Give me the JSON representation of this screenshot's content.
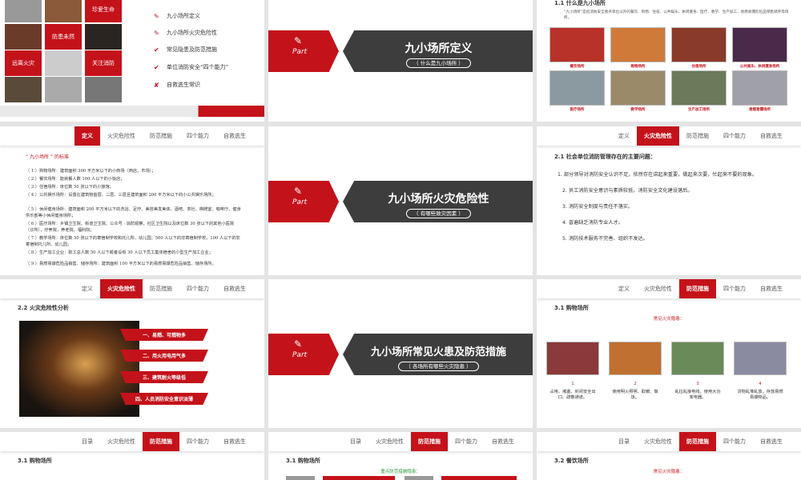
{
  "slide1": {
    "tiles": [
      "珍爱生命",
      "防患未然",
      "远离火灾",
      "关注消防"
    ],
    "toc": [
      {
        "icon": "fire-icon",
        "glyph": "✎",
        "label": "九小场所定义"
      },
      {
        "icon": "pencil-icon",
        "glyph": "✎",
        "label": "九小场所火灾危险性"
      },
      {
        "icon": "check-icon",
        "glyph": "✔",
        "label": "常见隐患及防范措施"
      },
      {
        "icon": "check-icon",
        "glyph": "✔",
        "label": "单位消防安全“四个能力”"
      },
      {
        "icon": "pencil-x-icon",
        "glyph": "✘",
        "label": "自救逃生常识"
      }
    ]
  },
  "slide2": {
    "part": "Part",
    "title": "九小场所定义",
    "sub": "（ 什么是九小场所 ）"
  },
  "slide3": {
    "heading": "1.1  什么是九小场所",
    "desc": "“九小场所”是指消防安全重点单位以外的餐饮、购物、住宿、公共娱乐、休闲健身、医疗、教学、生产加工、易燃易爆危险品销售储存等场所。",
    "captions": [
      "餐饮场所",
      "购物场所",
      "住宿场所",
      "公共娱乐、休闲健身场所",
      "医疗场所",
      "教学场所",
      "生产加工场所",
      "易燃易爆场所"
    ]
  },
  "tabs": [
    "定义",
    "火灾危险性",
    "防范措施",
    "四个能力",
    "自救逃生"
  ],
  "tabs_with_toc": [
    "目录",
    "火灾危险性",
    "防范措施",
    "四个能力",
    "自救逃生"
  ],
  "tabs_dingyi": [
    "定义",
    "火灾危险性",
    "防范措施",
    "四个能力",
    "自救逃生"
  ],
  "slide4": {
    "title": "“ 九小场所 ” 的标准",
    "items": [
      "（ 1 ）购物场所：建筑面积 300 平方米以下的小商场（商店、市场）；",
      "（ 2 ）餐饮场所：能就餐人数 100 人以下的小饭店；",
      "（ 3 ）住宿场所：床位数 50 张以下的小旅馆；",
      "（ 4 ）公共娱乐场所：设置在建筑物首层、二层、三层且建筑面积 200 平方米以下的小公共娱乐场所；",
      "（ 5 ）休闲健身场所：建筑面积 200 平方米以下的洗浴、足疗、美容美发美体、酒吧、茶社、棋牌室、咖啡厅、健身供乐部等小休闲健身场所；",
      "（ 6 ）医疗场所：乡镇卫生院、街道卫生院、公众号 · 消防观察，社区卫生院以及床位数 30 张以下的其他小医院（诊所），疗养院，养老院，福利院；",
      "（ 7 ）教学场所：床位数 50 张以下的寄宿制学校和托儿所、幼儿园；500 人以下的非寄宿制学校，100 人以下的非寄宿制托儿所、幼儿园；",
      "（ 8 ）生产加工企业：职工总人数 50 人以下或者设有 30 人以下员工集体宿舍的小型生产加工企业；",
      "（ 9 ）易燃易爆危险品销售、储存场所：建筑面积 100 平方米以下的易燃易爆危险品销售、储存场所。"
    ]
  },
  "slide5": {
    "part": "Part",
    "title": "九小场所火灾危险性",
    "sub": "（ 有哪些致灾因素 ）"
  },
  "slide6": {
    "heading": "2.1 社会单位消防管理存在的主要问题：",
    "items": [
      "1. 部分领导对消防安全认识不足，依然存在讲起来重要，做起来次要，忙起来不要的现象。",
      "2. 员工消防安全意识与素质较低，消防安全文化建设落后。",
      "3. 消防安全制度与责任不落实。",
      "4. 普遍缺乏消防专业人才。",
      "5. 消防技术服务不完善、组织不发达。"
    ]
  },
  "slide7": {
    "heading": "2.2  火灾危险性分析",
    "bars": [
      "一、易燃、可燃物多",
      "二、用火用电用气多",
      "三、建筑耐火等级低",
      "四、人员消防安全意识淡薄"
    ]
  },
  "slide8": {
    "part": "Part",
    "title": "九小场所常见火患及防范措施",
    "sub": "（ 各场所有哪些火灾隐患 ）"
  },
  "slide9": {
    "heading": "3.1  购物场所",
    "sub": "常见火灾隐患：",
    "nums": [
      "1",
      "2",
      "3",
      "4"
    ],
    "texts": [
      "占用、堵塞、封闭安全出口、疏散通道。",
      "使用明火照明、取暖、做饭。",
      "乱拉乱接电线，使用大功率电器。",
      "货物乱堆乱放，存放易燃易爆物品。"
    ]
  },
  "slide10": {
    "heading": "3.1  购物场所"
  },
  "slide11": {
    "heading": "3.1  购物场所",
    "sub": "重点防范措施隐患："
  },
  "slide12": {
    "heading": "3.2  餐饮场所",
    "sub": "常见火灾隐患："
  },
  "colors": {
    "accent": "#c4121a",
    "dark": "#3d3d3d"
  }
}
